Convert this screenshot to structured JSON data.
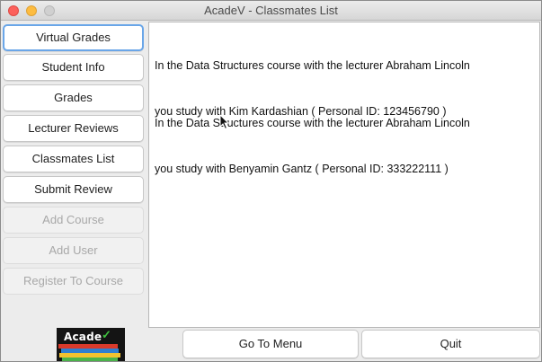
{
  "window": {
    "title": "AcadeV - Classmates List"
  },
  "sidebar": {
    "items": [
      {
        "label": "Virtual Grades",
        "enabled": true,
        "focused": true
      },
      {
        "label": "Student Info",
        "enabled": true
      },
      {
        "label": "Grades",
        "enabled": true
      },
      {
        "label": "Lecturer Reviews",
        "enabled": true
      },
      {
        "label": "Classmates List",
        "enabled": true
      },
      {
        "label": "Submit Review",
        "enabled": true
      },
      {
        "label": "Add Course",
        "enabled": false
      },
      {
        "label": "Add User",
        "enabled": false
      },
      {
        "label": "Register To Course",
        "enabled": false
      }
    ]
  },
  "content": {
    "entries": [
      {
        "line1": "In the Data Structures course with the lecturer Abraham Lincoln",
        "line2": "you study with Kim Kardashian ( Personal ID: 123456790 )"
      },
      {
        "line1": "In the Data Structures course with the lecturer Abraham Lincoln",
        "line2": "you study with Benyamin Gantz ( Personal ID: 333222111 )"
      }
    ]
  },
  "logo": {
    "text": "Acade",
    "check": "✓"
  },
  "footer": {
    "menu_label": "Go To Menu",
    "quit_label": "Quit"
  },
  "colors": {
    "focus_ring": "#6aa6e8",
    "close": "#fc605b",
    "minimize": "#fdbc40",
    "logo_check": "#3fbf3f"
  }
}
